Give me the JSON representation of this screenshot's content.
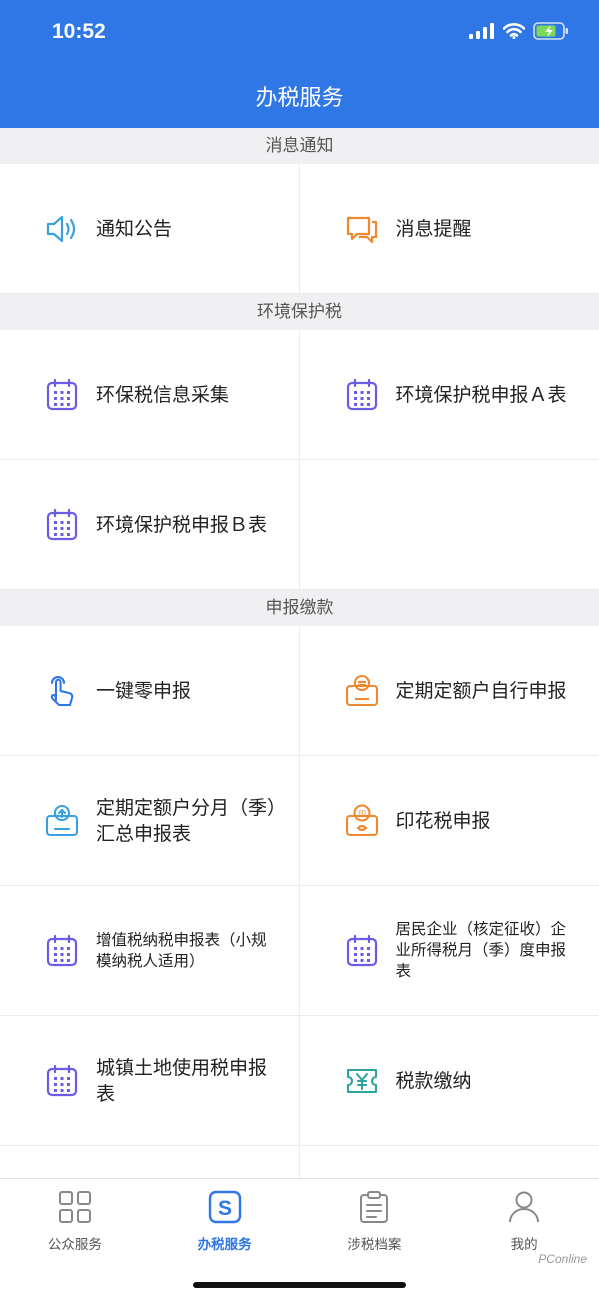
{
  "status_bar": {
    "time": "10:52"
  },
  "header": {
    "title": "办税服务"
  },
  "sections": [
    {
      "title": "消息通知",
      "items": [
        {
          "label": "通知公告",
          "icon": "speaker-icon"
        },
        {
          "label": "消息提醒",
          "icon": "chat-bubbles-icon"
        }
      ]
    },
    {
      "title": "环境保护税",
      "items": [
        {
          "label": "环保税信息采集",
          "icon": "calendar-icon"
        },
        {
          "label": "环境保护税申报Ａ表",
          "icon": "calendar-icon"
        },
        {
          "label": "环境保护税申报Ｂ表",
          "icon": "calendar-icon"
        }
      ]
    },
    {
      "title": "申报缴款",
      "items": [
        {
          "label": "一键零申报",
          "icon": "tap-hand-icon"
        },
        {
          "label": "定期定额户自行申报",
          "icon": "self-declare-icon"
        },
        {
          "label": "定期定额户分月（季）汇总申报表",
          "icon": "upload-form-icon"
        },
        {
          "label": "印花税申报",
          "icon": "stamp-icon"
        },
        {
          "label": "增值税纳税申报表（小规模纳税人适用）",
          "icon": "calendar-icon"
        },
        {
          "label": "居民企业（核定征收）企业所得税月（季）度申报表",
          "icon": "calendar-icon"
        },
        {
          "label": "城镇土地使用税申报表",
          "icon": "calendar-icon"
        },
        {
          "label": "税款缴纳",
          "icon": "yen-ticket-icon"
        }
      ]
    }
  ],
  "tabbar": {
    "items": [
      {
        "label": "公众服务",
        "icon": "grid-icon"
      },
      {
        "label": "办税服务",
        "icon": "s-badge-icon"
      },
      {
        "label": "涉税档案",
        "icon": "clipboard-icon"
      },
      {
        "label": "我的",
        "icon": "person-icon"
      }
    ],
    "active_index": 1
  },
  "watermark": "PConline",
  "colors": {
    "primary": "#2f76e6",
    "calendar": "#6b5ce7",
    "orange": "#f0892e",
    "light_blue": "#3aa0e0"
  }
}
